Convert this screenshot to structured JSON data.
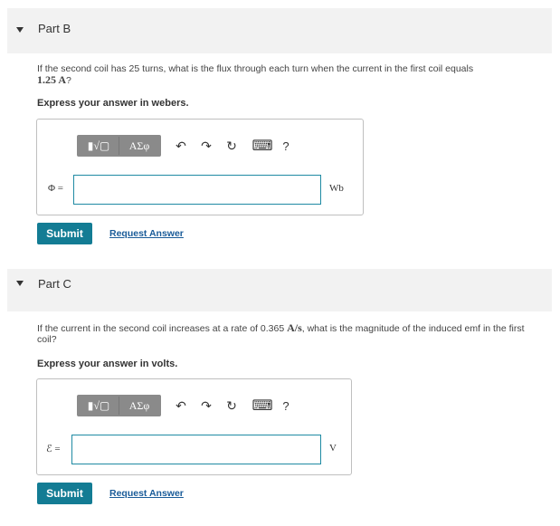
{
  "partB": {
    "title": "Part B",
    "question_pre": "If the second coil has 25 turns, what is the flux through each turn when the current in the first coil equals",
    "question_value": "1.25 A",
    "question_post": "?",
    "express": "Express your answer in webers.",
    "variable": "Φ =",
    "unit": "Wb",
    "input_value": "",
    "submit_label": "Submit",
    "request_label": "Request Answer"
  },
  "partC": {
    "title": "Part C",
    "question_pre": "If the current in the second coil increases at a rate of 0.365",
    "question_value": "A/s",
    "question_post": ", what is the magnitude of the induced emf in the first coil?",
    "express": "Express your answer in volts.",
    "variable": "ℰ =",
    "unit": "V",
    "input_value": "",
    "submit_label": "Submit",
    "request_label": "Request Answer"
  },
  "toolbar": {
    "template_btn": "▮√▢",
    "symbol_btn": "ΑΣφ",
    "undo_icon": "↶",
    "redo_icon": "↷",
    "reset_icon": "↻",
    "keyboard_icon": "⌨",
    "help_icon": "?"
  }
}
